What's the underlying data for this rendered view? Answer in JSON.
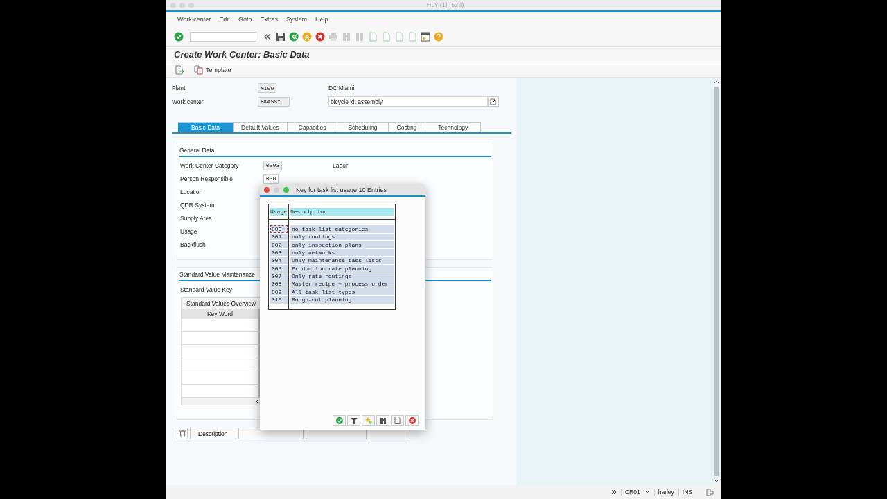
{
  "window": {
    "title": "HLY (1) (523)"
  },
  "menu": [
    "Work center",
    "Edit",
    "Goto",
    "Extras",
    "System",
    "Help"
  ],
  "screen_title": "Create Work Center: Basic Data",
  "template_button": {
    "label": "Template"
  },
  "header": [
    {
      "label": "Plant",
      "value": "MI00",
      "description": "DC Miami",
      "kind": "text"
    },
    {
      "label": "Work center",
      "value": "BKASSY",
      "description": "bicycle kit assembly",
      "kind": "field"
    }
  ],
  "tabs": [
    {
      "label": "Basic Data",
      "selected": true
    },
    {
      "label": "Default Values",
      "selected": false
    },
    {
      "label": "Capacities",
      "selected": false
    },
    {
      "label": "Scheduling",
      "selected": false
    },
    {
      "label": "Costing",
      "selected": false
    },
    {
      "label": "Technology",
      "selected": false
    }
  ],
  "general_data": {
    "title": "General Data",
    "fields": [
      {
        "label": "Work Center Category",
        "value": "0003",
        "description": "Labor",
        "editable": false
      },
      {
        "label": "Person Responsible",
        "value": "000",
        "editable": true
      },
      {
        "label": "Location"
      },
      {
        "label": "QDR System"
      },
      {
        "label": "Supply Area"
      },
      {
        "label": "Usage"
      },
      {
        "label": "Backflush"
      }
    ]
  },
  "standard_values": {
    "title": "Standard Value Maintenance",
    "key_label": "Standard Value Key",
    "overview_title": "Standard Values Overview",
    "columns": [
      "Key Word"
    ]
  },
  "bottom_buttons": [
    {
      "label": "Description"
    }
  ],
  "dialog": {
    "title": "Key for task list usage 10 Entries",
    "columns": [
      "Usage",
      "Description"
    ],
    "rows": [
      {
        "usage": "000",
        "description": "no task list categories",
        "selected": true
      },
      {
        "usage": "001",
        "description": "only routings",
        "selected": false
      },
      {
        "usage": "002",
        "description": "only inspection plans",
        "selected": false
      },
      {
        "usage": "003",
        "description": "only networks",
        "selected": false
      },
      {
        "usage": "004",
        "description": "Only maintenance task lists",
        "selected": false
      },
      {
        "usage": "005",
        "description": "Production rate planning",
        "selected": false
      },
      {
        "usage": "007",
        "description": "Only rate routings",
        "selected": false
      },
      {
        "usage": "008",
        "description": "Master recipe + process order",
        "selected": false
      },
      {
        "usage": "009",
        "description": "All task list types",
        "selected": false
      },
      {
        "usage": "010",
        "description": "Rough-cut planning",
        "selected": false
      }
    ]
  },
  "status_bar": {
    "system": "CR01",
    "user": "harley",
    "mode": "INS"
  }
}
